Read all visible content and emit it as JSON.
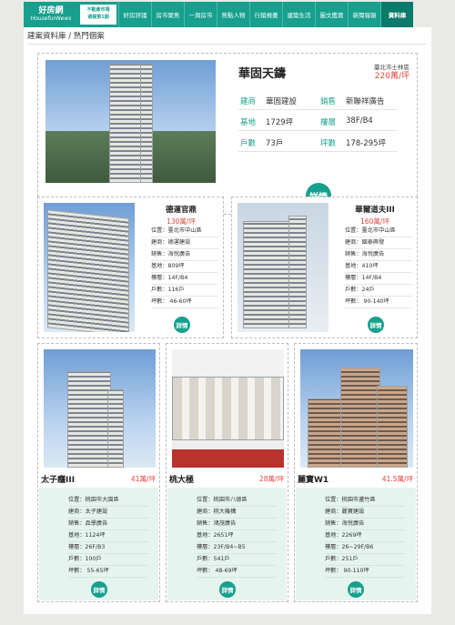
{
  "nav": {
    "logo_line1": "好房網",
    "logo_line2": "HousefunNews",
    "badge_line1": "不動產市場",
    "badge_line2": "週報第1期",
    "items": [
      "好房評議",
      "房市聚焦",
      "一周房市",
      "焦點人物",
      "行銷規畫",
      "建築生活",
      "圖文鑑賞",
      "新聞報報",
      "資料庫"
    ],
    "active_index": 8
  },
  "breadcrumb": "建案資料庫 / 熱門個案",
  "featured": {
    "title": "華固天鑄",
    "location": "臺北市士林區",
    "price": "220萬/坪",
    "rows": [
      {
        "k1": "建商",
        "v1": "華固建設",
        "k2": "銷售",
        "v2": "新聯祥廣告"
      },
      {
        "k1": "基地",
        "v1": "1729坪",
        "k2": "樓層",
        "v2": "38F/B4"
      },
      {
        "k1": "戶數",
        "v1": "73戶",
        "k2": "坪數",
        "v2": "178-295坪"
      }
    ],
    "detail_label": "詳情"
  },
  "middle": [
    {
      "title": "德運官鼎",
      "price": "130萬/坪",
      "rows": [
        "位置：臺北市中山區",
        "建商：德運建設",
        "銷售：海悅廣告",
        "基地：809坪",
        "樓層：14F/B4",
        "戶數：116戶",
        "坪數： 46-60坪"
      ],
      "detail_label": "詳情"
    },
    {
      "title": "華爾道夫III",
      "price": "160萬/坪",
      "rows": [
        "位置：臺北市中山區",
        "建商：國泰興發",
        "銷售：海悅廣告",
        "基地：410坪",
        "樓層：14F/B4",
        "戶數：24戶",
        "坪數： 90-140坪"
      ],
      "detail_label": "詳情"
    }
  ],
  "bottom": [
    {
      "title": "太子癮III",
      "price": "41萬/坪",
      "rows": [
        "位置：桃園市大園區",
        "建商：太子建設",
        "銷售：品學廣告",
        "基地：1124坪",
        "樓層：26F/B3",
        "戶數：100戶",
        "坪數： 55-65坪"
      ],
      "detail_label": "詳情"
    },
    {
      "title": "桃大極",
      "price": "28萬/坪",
      "rows": [
        "位置：桃園市八德區",
        "建商：桃大機構",
        "銷售：鴻茂廣告",
        "基地：2651坪",
        "樓層：23F/B4~B5",
        "戶數：541戶",
        "坪數： 48-69坪"
      ],
      "detail_label": "詳情"
    },
    {
      "title": "麗寶W1",
      "price": "41.5萬/坪",
      "rows": [
        "位置：桃園市蘆竹區",
        "建商：麗寶建設",
        "銷售：海悅廣告",
        "基地：2269坪",
        "樓層：26~29F/B6",
        "戶數：251戶",
        "坪數： 90-110坪"
      ],
      "detail_label": "詳情"
    }
  ],
  "colors": {
    "accent": "#16a08d",
    "price": "#e0463d",
    "info_bg": "#e6f4ef"
  }
}
